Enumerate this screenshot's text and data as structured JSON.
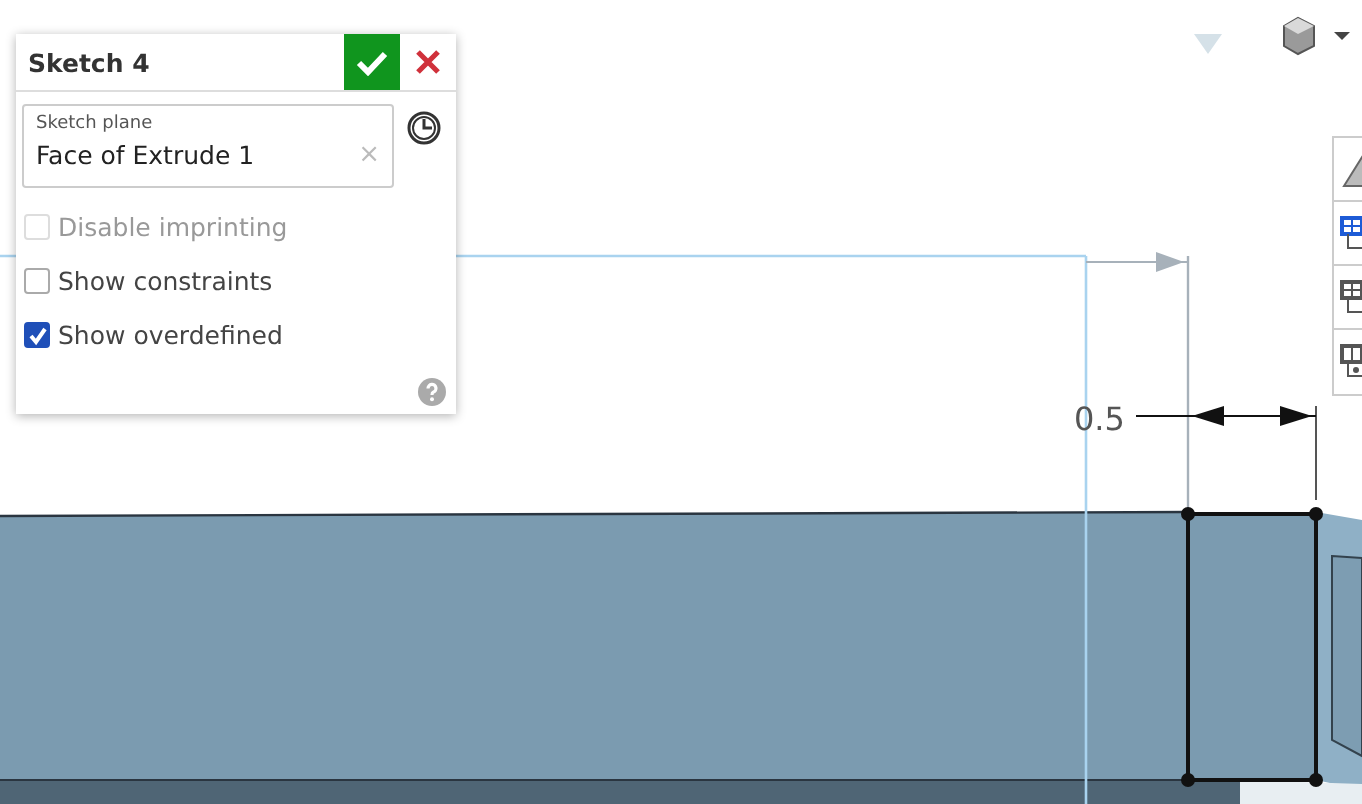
{
  "panel": {
    "title": "Sketch 4",
    "plane_field": {
      "label": "Sketch plane",
      "value": "Face of Extrude 1",
      "clear": "×"
    },
    "options": [
      {
        "label": "Disable imprinting",
        "checked": false,
        "disabled": true
      },
      {
        "label": "Show constraints",
        "checked": false,
        "disabled": false
      },
      {
        "label": "Show overdefined",
        "checked": true,
        "disabled": false
      }
    ]
  },
  "viewport": {
    "dimension": "0.5"
  }
}
